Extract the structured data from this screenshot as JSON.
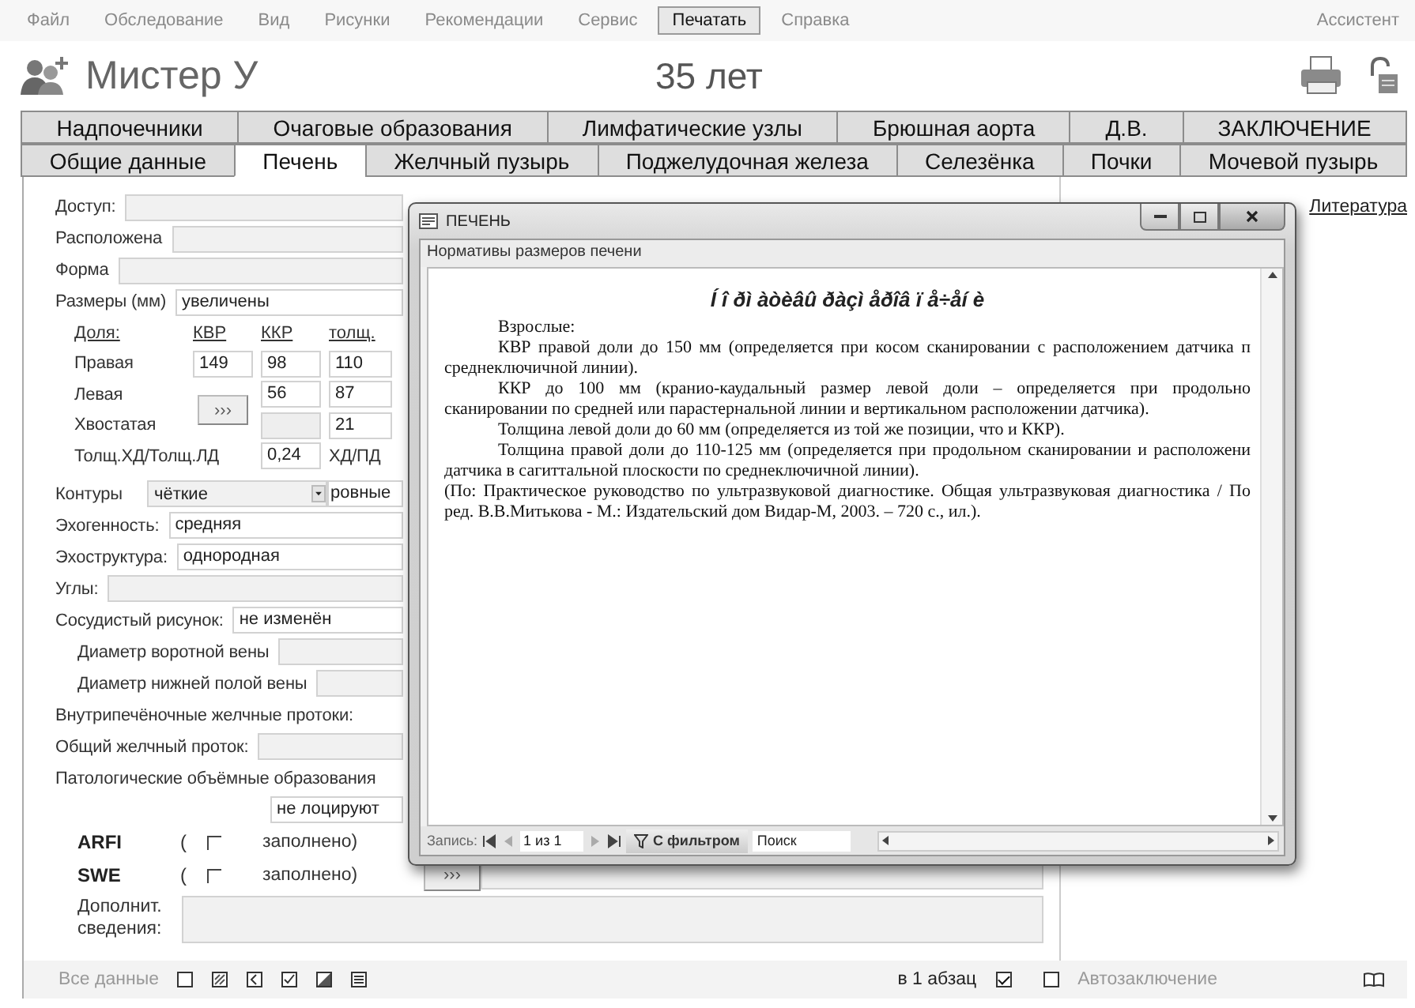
{
  "menu": {
    "items": [
      {
        "label": "Файл",
        "selected": false
      },
      {
        "label": "Обследование",
        "selected": false
      },
      {
        "label": "Вид",
        "selected": false
      },
      {
        "label": "Рисунки",
        "selected": false
      },
      {
        "label": "Рекомендации",
        "selected": false
      },
      {
        "label": "Сервис",
        "selected": false
      },
      {
        "label": "Печатать",
        "selected": true
      },
      {
        "label": "Справка",
        "selected": false
      }
    ],
    "assistant": "Ассистент"
  },
  "header": {
    "patient": "Мистер У",
    "age": "35 лет"
  },
  "tab_rows": [
    {
      "tabs": [
        {
          "label": "Надпочечники",
          "selected": false
        },
        {
          "label": "Очаговые образования",
          "selected": false
        },
        {
          "label": "Лимфатические узлы",
          "selected": false
        },
        {
          "label": "Брюшная аорта",
          "selected": false
        },
        {
          "label": "Д.В.",
          "selected": false
        },
        {
          "label": "ЗАКЛЮЧЕНИЕ",
          "selected": false
        }
      ]
    },
    {
      "tabs": [
        {
          "label": "Общие данные",
          "selected": false
        },
        {
          "label": "Печень",
          "selected": true
        },
        {
          "label": "Желчный пузырь",
          "selected": false
        },
        {
          "label": "Поджелудочная железа",
          "selected": false
        },
        {
          "label": "Селезёнка",
          "selected": false
        },
        {
          "label": "Почки",
          "selected": false
        },
        {
          "label": "Мочевой пузырь",
          "selected": false
        }
      ]
    }
  ],
  "form": {
    "top_fields": [
      {
        "label": "Доступ:"
      },
      {
        "label": "Расположена"
      },
      {
        "label": "Форма"
      },
      {
        "label": "Размеры (мм)",
        "value": "увеличены"
      }
    ],
    "sizes": {
      "headers": [
        "Доля:",
        "КВР",
        "ККР",
        "толщ."
      ],
      "button": "›››",
      "rows": [
        {
          "label": "Правая",
          "kvr": "149",
          "kkr": "98",
          "thick": "110",
          "kkr_disabled": false
        },
        {
          "label": "Левая",
          "kkr": "56",
          "thick": "87",
          "kkr_disabled": false
        },
        {
          "label": "Хвостатая",
          "thick": "21",
          "kkr_disabled": true
        }
      ],
      "ratio": {
        "label": "Толщ.ХД/Толщ.ЛД",
        "value": "0,24",
        "unit": "ХД/ПД"
      }
    },
    "contours": {
      "label": "Контуры",
      "value": "чёткие",
      "second_value": "ровные"
    },
    "rows": [
      {
        "kind": "field",
        "label": "Эхогенность:",
        "value": "средняя",
        "indented": false
      },
      {
        "kind": "field",
        "label": "Эхоструктура:",
        "value": "однородная",
        "indented": false
      },
      {
        "kind": "field",
        "label": "Углы:",
        "indented": false
      },
      {
        "kind": "field",
        "label": "Сосудистый рисунок:",
        "value": "не изменён",
        "indented": false
      },
      {
        "kind": "field",
        "label": "Диаметр воротной вены",
        "indented": true
      },
      {
        "kind": "field",
        "label": "Диаметр нижней полой вены",
        "indented": true
      },
      {
        "kind": "label",
        "label": "Внутрипечёночные желчные протоки:"
      },
      {
        "kind": "field",
        "label": "Общий желчный проток:",
        "indented": false
      },
      {
        "kind": "label",
        "label": "Патологические объёмные образования"
      },
      {
        "kind": "value",
        "value": "не лоцируют"
      }
    ],
    "elastography": [
      {
        "label": "ARFI",
        "paren": "(",
        "checked": false,
        "note": "заполнено)"
      },
      {
        "label": "SWE",
        "paren": "(",
        "checked": false,
        "note": "заполнено)",
        "button": "›››"
      }
    ],
    "extra": {
      "label": "Дополнит. сведения:"
    }
  },
  "side_link": "Литература",
  "popup": {
    "title": "ПЕЧЕНЬ",
    "section_label": "Нормативы размеров печени",
    "doc_title": "Í î ðì àòèâû ðàçì åðîâ ï å÷åí è",
    "paragraphs": [
      {
        "indent": true,
        "lines": [
          "Взрослые:"
        ]
      },
      {
        "indent": true,
        "lines": [
          "КВР правой доли до 150 мм (определяется при косом сканировании с расположением датчика п",
          "среднеключичной линии)."
        ]
      },
      {
        "indent": true,
        "lines": [
          "ККР до 100 мм (кранио-каудальный размер левой доли – определяется при продольно",
          "сканировании по средней или парастернальной линии и вертикальном расположении датчика)."
        ]
      },
      {
        "indent": true,
        "lines": [
          "Толщина левой доли до  60 мм (определяется из той же позиции, что и ККР)."
        ]
      },
      {
        "indent": true,
        "lines": [
          "Толщина правой доли до 110-125 мм (определяется при продольном сканировании и расположени",
          "датчика в сагиттальной плоскости по среднеключичной линии)."
        ]
      },
      {
        "indent": false,
        "lines": [
          "(По: Практическое руководство по ультразвуковой диагностике. Общая ультразвуковая диагностика / По",
          "ред. В.В.Митькова  - М.: Издательский дом Видар-М, 2003. – 720 с., ил.)."
        ]
      }
    ],
    "nav": {
      "label": "Запись:",
      "position": "1 из 1",
      "filter": "С фильтром",
      "search_placeholder": "Поиск"
    }
  },
  "footer": {
    "label": "Все данные",
    "paragraph_toggle": {
      "label": "в 1 абзац",
      "checked": true
    },
    "auto": {
      "label": "Автозаключение",
      "checked": false
    }
  }
}
